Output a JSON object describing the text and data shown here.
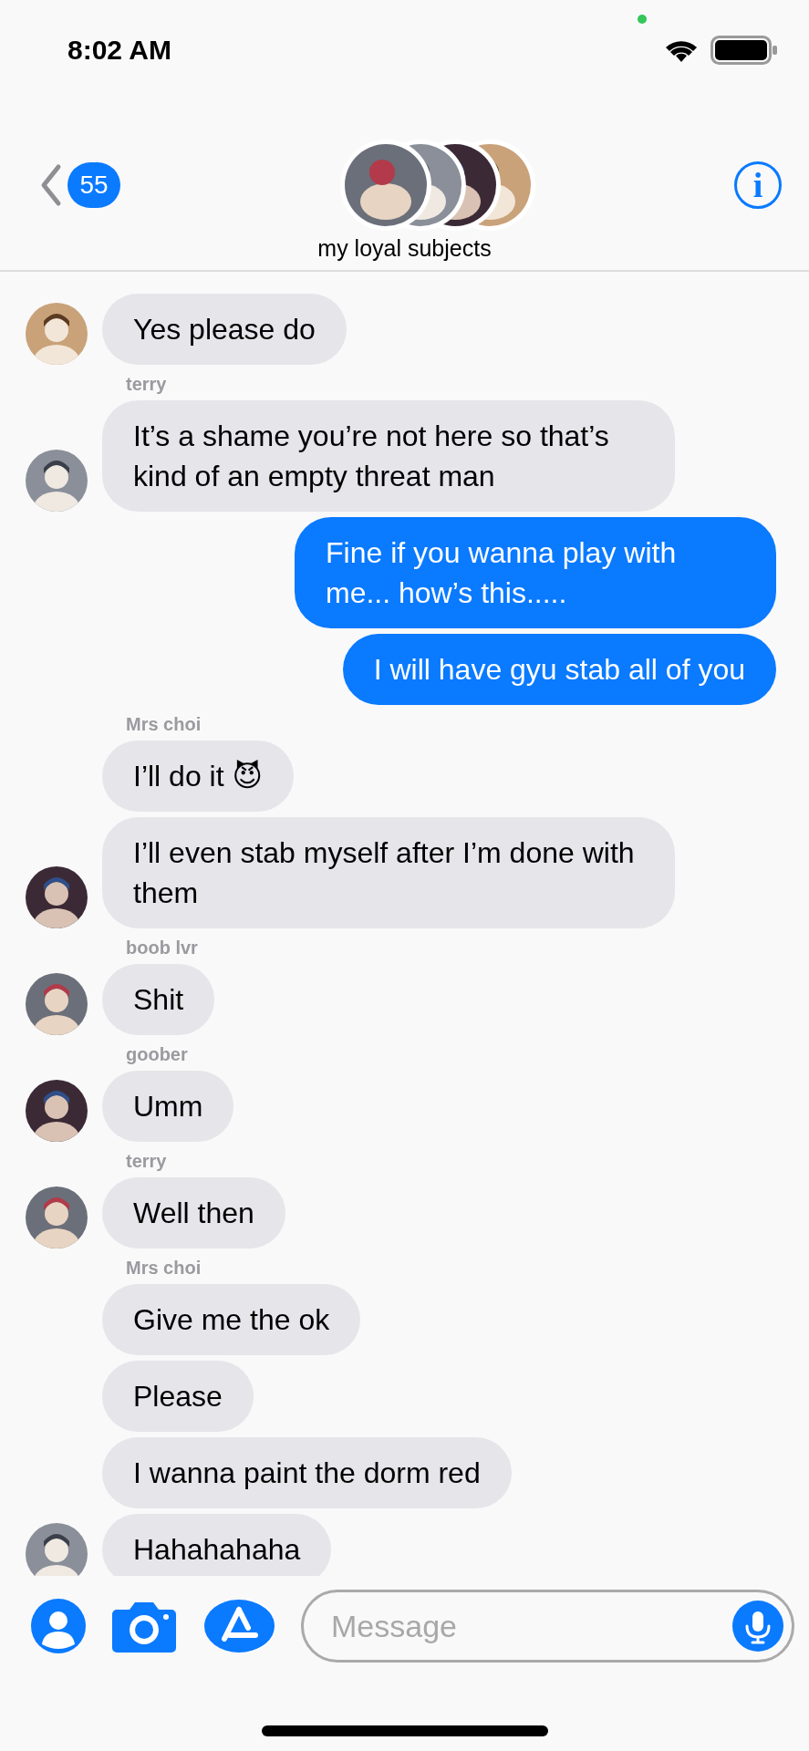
{
  "status_bar": {
    "time": "8:02 AM"
  },
  "nav": {
    "back_count": "55",
    "title": "my loyal subjects",
    "info": "i"
  },
  "messages": [
    {
      "kind": "incoming",
      "text": "Yes please do",
      "avatar": true
    },
    {
      "kind": "sender",
      "text": "terry"
    },
    {
      "kind": "incoming",
      "text": "It’s a shame you’re not here so that’s kind of an empty threat man",
      "avatar": true
    },
    {
      "kind": "outgoing",
      "text": "Fine if you wanna play with me... how’s this....."
    },
    {
      "kind": "outgoing",
      "text": "I will have gyu stab all of you"
    },
    {
      "kind": "sender",
      "text": "Mrs choi"
    },
    {
      "kind": "incoming",
      "text": "I’ll do it 😈",
      "avatar": false
    },
    {
      "kind": "incoming",
      "text": "I’ll even stab myself after I’m done with them",
      "avatar": true
    },
    {
      "kind": "sender",
      "text": "boob lvr"
    },
    {
      "kind": "incoming",
      "text": "Shit",
      "avatar": true
    },
    {
      "kind": "sender",
      "text": "goober"
    },
    {
      "kind": "incoming",
      "text": "Umm",
      "avatar": true
    },
    {
      "kind": "sender",
      "text": "terry"
    },
    {
      "kind": "incoming",
      "text": "Well then",
      "avatar": true
    },
    {
      "kind": "sender",
      "text": "Mrs choi"
    },
    {
      "kind": "incoming",
      "text": "Give me the ok",
      "avatar": false
    },
    {
      "kind": "incoming",
      "text": "Please",
      "avatar": false
    },
    {
      "kind": "incoming",
      "text": "I wanna paint the dorm red",
      "avatar": false
    },
    {
      "kind": "incoming",
      "text": "Hahahahaha",
      "avatar": true
    }
  ],
  "composer": {
    "placeholder": "Message"
  }
}
